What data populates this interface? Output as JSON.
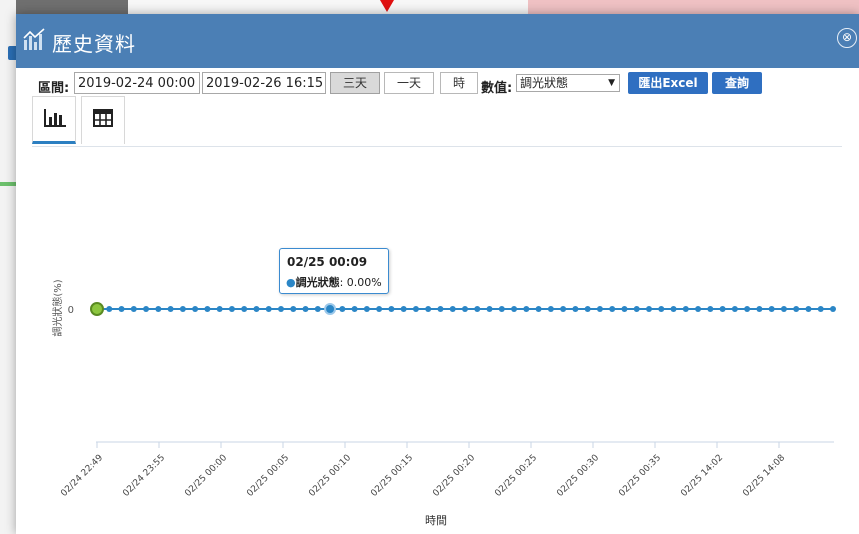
{
  "window": {
    "title": "歷史資料",
    "close_symbol": "⊗"
  },
  "toolbar": {
    "range_label": "區間:",
    "start_value": "2019-02-24 00:00",
    "end_value": "2019-02-26 16:15",
    "buttons": [
      "三天",
      "一天",
      "時"
    ],
    "active_button": "三天",
    "value_label": "數值:",
    "value_selected": "調光狀態",
    "export_label": "匯出Excel",
    "query_label": "查詢"
  },
  "tabs": [
    {
      "icon": "bar-chart-icon",
      "active": true
    },
    {
      "icon": "table-icon",
      "active": false
    }
  ],
  "tooltip": {
    "title": "02/25 00:09",
    "series": "調光狀態",
    "value": ": 0.00%",
    "bullet": "●"
  },
  "colors": {
    "titlebar": "#4b7fb5",
    "series": "#2b86c6",
    "first_point": "#8cc63f",
    "primary_button": "#2f6fc1"
  },
  "chart_data": {
    "type": "line",
    "xlabel": "時間",
    "ylabel": "調光狀態(%)",
    "y_tick_labels": [
      "0"
    ],
    "x_tick_labels": [
      "02/24 22:49",
      "02/24 23:55",
      "02/25 00:00",
      "02/25 00:05",
      "02/25 00:10",
      "02/25 00:15",
      "02/25 00:20",
      "02/25 00:25",
      "02/25 00:30",
      "02/25 00:35",
      "02/25 14:02",
      "02/25 14:08"
    ],
    "series": [
      {
        "name": "調光狀態",
        "point_count": 61,
        "values": [
          0,
          0,
          0,
          0,
          0,
          0,
          0,
          0,
          0,
          0,
          0,
          0,
          0,
          0,
          0,
          0,
          0,
          0,
          0,
          0,
          0,
          0,
          0,
          0,
          0,
          0,
          0,
          0,
          0,
          0,
          0,
          0,
          0,
          0,
          0,
          0,
          0,
          0,
          0,
          0,
          0,
          0,
          0,
          0,
          0,
          0,
          0,
          0,
          0,
          0,
          0,
          0,
          0,
          0,
          0,
          0,
          0,
          0,
          0,
          0,
          0
        ]
      }
    ],
    "highlighted_point_index": 19,
    "first_point_highlighted": true
  }
}
